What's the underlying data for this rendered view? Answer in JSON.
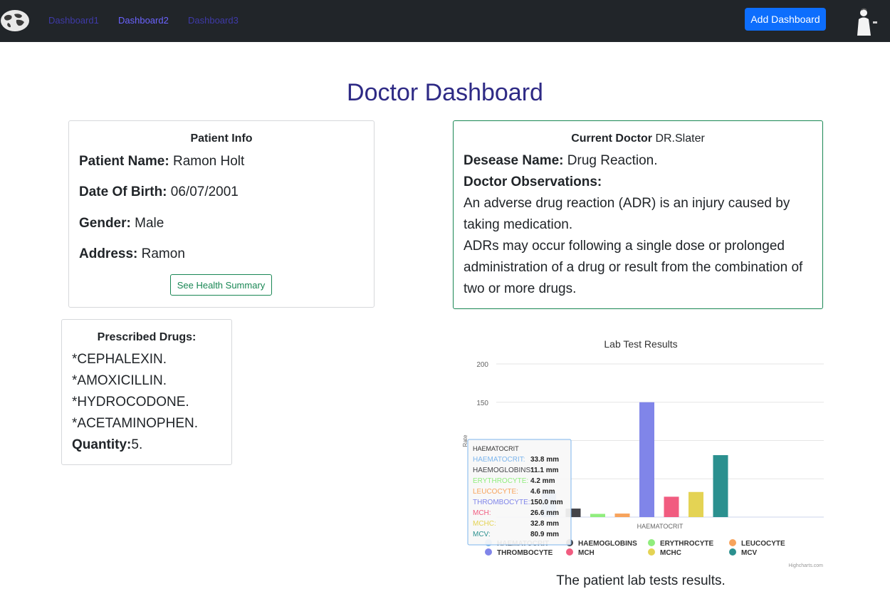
{
  "nav": {
    "links": [
      "Dashboard1",
      "Dashboard2",
      "Dashboard3"
    ],
    "active_index": 1,
    "add_button": "Add Dashboard"
  },
  "page_title": "Doctor Dashboard",
  "patient": {
    "heading": "Patient Info",
    "name_label": "Patient Name:",
    "name": "Ramon Holt",
    "dob_label": "Date Of Birth:",
    "dob": "06/07/2001",
    "gender_label": "Gender:",
    "gender": "Male",
    "address_label": "Address:",
    "address": "Ramon",
    "summary_button": "See Health Summary"
  },
  "doctor": {
    "heading_label": "Current Doctor",
    "heading_value": "DR.Slater",
    "disease_label": "Desease Name:",
    "disease": "Drug Reaction.",
    "observations_label": "Doctor Observations:",
    "observations": [
      "An adverse drug reaction (ADR) is an injury caused by taking medication.",
      "ADRs may occur following a single dose or prolonged administration of a drug or result from the combination of two or more drugs."
    ]
  },
  "drugs": {
    "heading": "Prescribed Drugs:",
    "items": [
      "*CEPHALEXIN.",
      "*AMOXICILLIN.",
      "*HYDROCODONE.",
      "*ACETAMINOPHEN."
    ],
    "quantity_label": "Quantity:",
    "quantity": "5."
  },
  "chart_data": {
    "type": "bar",
    "title": "Lab Test Results",
    "ylabel": "Rate",
    "xlabel": "HAEMATOCRIT",
    "ylim": [
      0,
      200
    ],
    "yticks": [
      150,
      200
    ],
    "grid": true,
    "legend_position": "bottom",
    "categories": [
      "HAEMATOCRIT"
    ],
    "series": [
      {
        "name": "HAEMATOCRIT",
        "values": [
          33.8
        ],
        "color": "#7cb5ec"
      },
      {
        "name": "HAEMOGLOBINS",
        "values": [
          11.1
        ],
        "color": "#434348"
      },
      {
        "name": "ERYTHROCYTE",
        "values": [
          4.2
        ],
        "color": "#90ed7d"
      },
      {
        "name": "LEUCOCYTE",
        "values": [
          4.6
        ],
        "color": "#f7a35c"
      },
      {
        "name": "THROMBOCYTE",
        "values": [
          150.0
        ],
        "color": "#8085e9"
      },
      {
        "name": "MCH",
        "values": [
          26.6
        ],
        "color": "#f15c80"
      },
      {
        "name": "MCHC",
        "values": [
          32.8
        ],
        "color": "#e4d354"
      },
      {
        "name": "MCV",
        "values": [
          80.9
        ],
        "color": "#2b908f"
      }
    ],
    "tooltip": {
      "header": "HAEMATOCRIT",
      "unit": "mm",
      "rows": [
        {
          "label": "HAEMATOCRIT:",
          "value": "33.8 mm"
        },
        {
          "label": "HAEMOGLOBINS:",
          "value": "11.1 mm"
        },
        {
          "label": "ERYTHROCYTE:",
          "value": "4.2 mm"
        },
        {
          "label": "LEUCOCYTE:",
          "value": "4.6 mm"
        },
        {
          "label": "THROMBOCYTE:",
          "value": "150.0 mm"
        },
        {
          "label": "MCH:",
          "value": "26.6 mm"
        },
        {
          "label": "MCHC:",
          "value": "32.8 mm"
        },
        {
          "label": "MCV:",
          "value": "80.9 mm"
        }
      ]
    },
    "credits": "Highcharts.com"
  },
  "chart_caption": "The patient lab tests results.",
  "colors": {
    "navbar": "#212529",
    "nav_link": "#3f3aa8",
    "nav_link_active": "#6b63ff",
    "title": "#2e2a85",
    "primary": "#0d6efd",
    "success": "#198754"
  }
}
